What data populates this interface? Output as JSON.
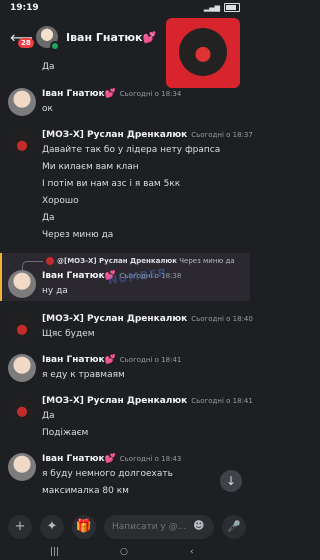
{
  "status_bar": {
    "time": "19:19",
    "battery": 0.85
  },
  "header": {
    "back_icon": "arrow-left-icon",
    "unread_badge": "28",
    "title": "Іван Гнатюк💕",
    "chevron": "›"
  },
  "messages": [
    {
      "lines": [
        "Да"
      ]
    },
    {
      "author": "Іван Гнатюк💕",
      "time": "Сьогодні о 18:34",
      "lines": [
        "ок"
      ]
    },
    {
      "author": "[МОЗ-Х]  Руслан Дренкалюк",
      "time": "Сьогодні о 18:37",
      "lines": [
        "Давайте так бо у лідера нету фрапса",
        "Ми килаєм вам клан",
        "І потім ви нам азс і я вам 5кк",
        "Хорошо",
        "Да",
        "Через миню да"
      ]
    },
    {
      "reply": {
        "author": "@[МОЗ-Х]  Руслан Дренкалюк",
        "text": "Через миню да"
      },
      "author": "Іван Гнатюк💕",
      "time": "Сьогодні о 18:38",
      "lines": [
        "ну да"
      ]
    },
    {
      "author": "[МОЗ-Х]  Руслан Дренкалюк",
      "time": "Сьогодні о 18:40",
      "lines": [
        "Щяс будем"
      ]
    },
    {
      "author": "Іван Гнатюк💕",
      "time": "Сьогодні о 18:41",
      "lines": [
        "я еду к травмаям"
      ]
    },
    {
      "author": "[МОЗ-Х]  Руслан Дренкалюк",
      "time": "Сьогодні о 18:41",
      "lines": [
        "Да",
        "Подіжаєм"
      ]
    },
    {
      "author": "Іван Гнатюк💕",
      "time": "Сьогодні о 18:43",
      "lines": [
        "я буду немного долгоехать",
        "максималка 80 км"
      ]
    }
  ],
  "composer": {
    "placeholder": "Написати у @...",
    "add_icon": "+",
    "apps_icon": "✦",
    "gift_icon": "🎁",
    "emoji_icon": "☻",
    "mic_icon": "🎤"
  },
  "scroll_icon": "↓",
  "navbar": {
    "menu": "|||",
    "home": "○",
    "back": "‹"
  }
}
